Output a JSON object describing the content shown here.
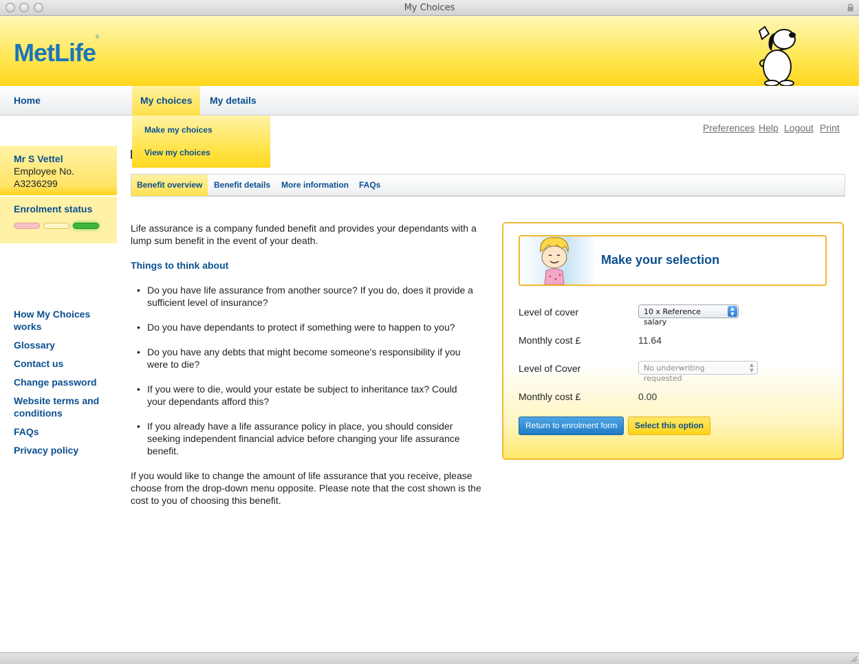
{
  "window": {
    "title": "My Choices"
  },
  "brand": {
    "logo": "MetLife",
    "logo_mark": "®"
  },
  "nav": {
    "home": "Home",
    "my_choices": "My choices",
    "my_details": "My details",
    "dropdown": [
      "Make my choices",
      "View my choices"
    ]
  },
  "utility": {
    "preferences": "Preferences",
    "help": "Help",
    "logout": "Logout",
    "print": "Print"
  },
  "user": {
    "name": "Mr S Vettel",
    "employee_label": "Employee No.",
    "employee_no": "A3236299"
  },
  "enrolment": {
    "title": "Enrolment status",
    "colors": [
      "#f6c3c3",
      "#fff4c6",
      "#3db43a"
    ]
  },
  "side_links": [
    "How My Choices works",
    "Glossary",
    "Contact us",
    "Change password",
    "Website terms and conditions",
    "FAQs",
    "Privacy policy"
  ],
  "subtabs": [
    "Benefit overview",
    "Benefit details",
    "More information",
    "FAQs"
  ],
  "content": {
    "intro": "Life assurance is a company funded benefit and provides your dependants with a lump sum benefit in the event of your death.",
    "heading": "Things to think about",
    "bullets": [
      "Do you have life assurance from another source? If you do, does it provide a sufficient level of insurance?",
      "Do you have dependants to protect if something were to happen to you?",
      "Do you have any debts that might become someone's responsibility if you were to die?",
      "If you were to die, would your estate be subject to inheritance tax? Could your dependants afford this?",
      "If you already have a life assurance policy in place, you should consider seeking independent financial advice before changing your life assurance benefit."
    ],
    "outro": "If you would like to change the amount of life assurance that you receive, please choose from the drop-down menu opposite. Please note that the cost shown is the cost to you of choosing this benefit."
  },
  "selection": {
    "title": "Make your selection",
    "level_label": "Level of cover",
    "level_value": "10 x Reference salary",
    "cost_label": "Monthly cost £",
    "cost_value": "11.64",
    "level2_label": "Level of Cover",
    "level2_value": "No underwriting requested",
    "cost2_label": "Monthly cost £",
    "cost2_value": "0.00",
    "return_button": "Return to enrolment form",
    "select_button": "Select this option"
  }
}
